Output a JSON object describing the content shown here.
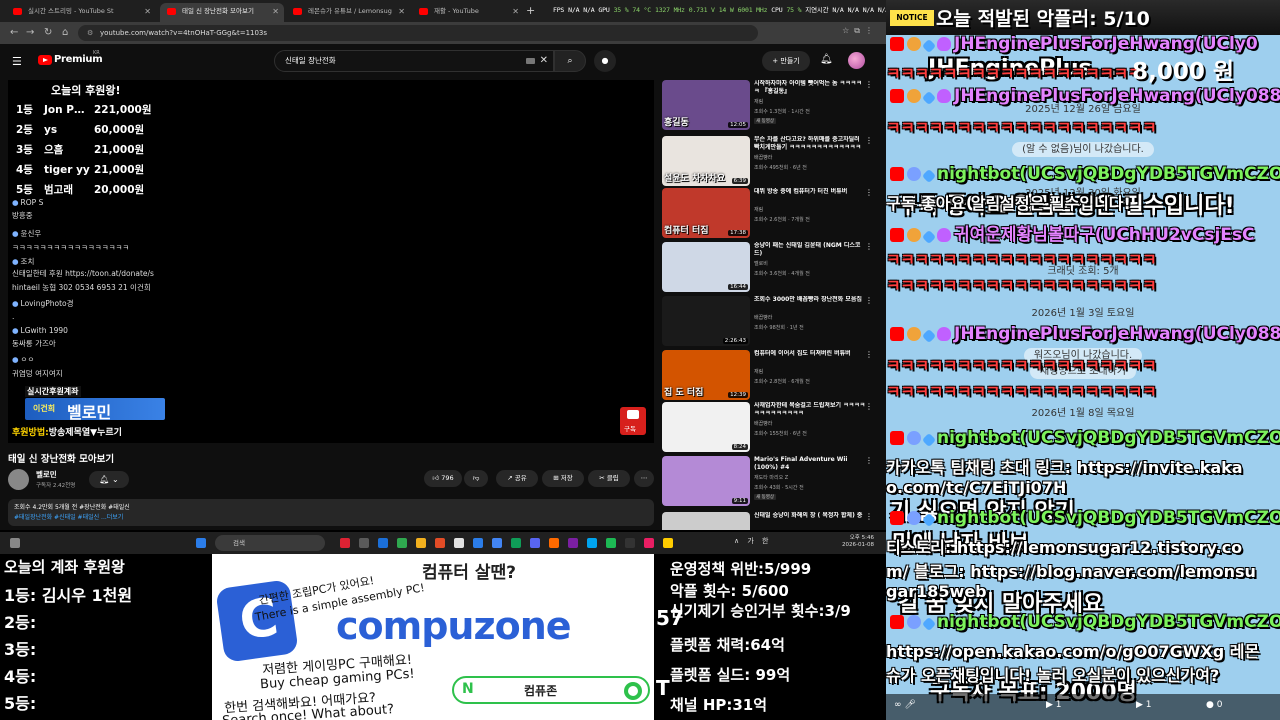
{
  "browser": {
    "tabs": [
      {
        "label": "실시간 스트리밍 - YouTube St"
      },
      {
        "label": "태일 신 장난전화 모아보기"
      },
      {
        "label": "레몬슈가 유튜브 / Lemonsug"
      },
      {
        "label": "재활 - YouTube"
      }
    ],
    "stats": [
      "FPS",
      "N/A",
      "N/A",
      "GPU",
      "35 %",
      "74 °C",
      "1327 MHz",
      "0.731 V",
      "14 W",
      "6001 MHz",
      "CPU",
      "75 %",
      "지연시간",
      "N/A",
      "N/A",
      "N/A",
      "N/A"
    ],
    "url": "youtube.com/watch?v=4tnOHaT-GGg&t=1103s"
  },
  "youtube": {
    "brand": "Premium",
    "region": "KR",
    "search_query": "신태일 장난전화",
    "create_label": "만들기"
  },
  "player": {
    "donor_title": "오늘의 후원왕!",
    "donors": [
      {
        "rank": "1등",
        "name": "Jon P…",
        "amount": "221,000원"
      },
      {
        "rank": "2등",
        "name": "ys",
        "amount": "60,000원"
      },
      {
        "rank": "3등",
        "name": "으흠",
        "amount": "21,000원"
      },
      {
        "rank": "4등",
        "name": "tiger yy",
        "amount": "21,000원"
      },
      {
        "rank": "5등",
        "name": "범고래",
        "amount": "20,000원"
      }
    ],
    "chat_lines": [
      "ROP S",
      "방흥중",
      "윤신우",
      "ㅋㅋㅋㅋㅋㅋㅋㅋㅋㅋㅋㅋㅋㅋㅋㅋㅋ",
      "조치",
      "신태일한테 후원 https://toon.at/donate/s",
      "hintaeil 농협 302 0534 6953 21 이건희",
      "LovingPhoto경",
      ".",
      "LGwith 1990",
      "동싸롱 가즈아",
      "ㅇㅇ",
      "귀염덩 여지여지"
    ],
    "badge_top": "실시간후원계좌",
    "badge_name_small": "이건희",
    "badge_name": "벨로민",
    "how_prefix": "후원방법:",
    "how_text": "방송제목열▼누르기",
    "subscribe_label": "구독"
  },
  "video": {
    "title": "태일 신 장난전화 모아보기",
    "channel": "벨로민",
    "subscribers": "구독자 2.42천명",
    "likes": "796",
    "share": "공유",
    "save": "저장",
    "clip": "클립",
    "desc_line1": "조회수 4.2만회  5개월 전  #장난전화 #태일신",
    "desc_line2": "#태일장난전화 #신태일 #태일신 ...더보기"
  },
  "sidebar": [
    {
      "title": "시작하자마자 아이템 뺏어먹는 놈 ㅋㅋㅋㅋㅋ 『홍길동』",
      "channel": "재림",
      "meta": "조회수 1.3천회 · 1시간 전",
      "badge": "새 동영상",
      "duration": "12:05",
      "caption": "홍길동",
      "thumb": "#6a4b8c"
    },
    {
      "title": "무슨 차를 산다고요? 하위매를 중고차딜러 빡치게만들기 ㅋㅋㅋㅋㅋㅋㅋㅋㅋㅋㅋㅋㅋㅋㅋ",
      "channel": "배꼽빵라",
      "meta": "조회수 495천회 · 6년 전",
      "badge": "",
      "duration": "6:39",
      "caption": "설윤도 차차차요",
      "thumb": "#e9e4df"
    },
    {
      "title": "대뷔 방송 중에 컴퓨터가 터진 버튜버",
      "channel": "재림",
      "meta": "조회수 2.6천회 · 7개월 전",
      "badge": "",
      "duration": "17:38",
      "caption": "컴퓨터 터짐",
      "thumb": "#c0392b"
    },
    {
      "title": "승냥이 패는 신태일 김윤태 (NGM 디스코드)",
      "channel": "멜로비",
      "meta": "조회수 3.6천회 · 4개월 전",
      "badge": "",
      "duration": "16:44",
      "caption": "",
      "thumb": "#cfd8e6"
    },
    {
      "title": "조회수 3000만 배꼽빵라 장난전화 모음집",
      "channel": "배꼽빵라",
      "meta": "조회수 98천회 · 1년 전",
      "badge": "",
      "duration": "2:26:43",
      "caption": "",
      "thumb": "#1a1a1a"
    },
    {
      "title": "컴퓨터에 이어서 집도 터져버린 버튜버",
      "channel": "재림",
      "meta": "조회수 2.8천회 · 6개월 전",
      "badge": "",
      "duration": "12:39",
      "caption": "집 도 터짐",
      "thumb": "#d35400"
    },
    {
      "title": "사채업자한테 목숨걸고 드립쳐보기 ㅋㅋㅋㅋㅋㅋㅋㅋㅋㅋㅋㅋㅋ",
      "channel": "배꼽빵라",
      "meta": "조회수 155천회 · 6년 전",
      "badge": "",
      "duration": "8:24",
      "caption": "",
      "thumb": "#f1f1f1"
    },
    {
      "title": "Mario's Final Adventure Wii (100%) #4",
      "channel": "재도타 마리오 Z",
      "meta": "조회수 43회 · 5시간 전",
      "badge": "새 동영상",
      "duration": "9:11",
      "caption": "",
      "thumb": "#b48ad6"
    },
    {
      "title": "신태일 승냥이 화해의 장 ( 목정자 합체) 중",
      "channel": "",
      "meta": "",
      "badge": "",
      "duration": "",
      "caption": "",
      "thumb": "#cccccc"
    }
  ],
  "taskbar": {
    "search": "검색",
    "tray": "∧ 가 한",
    "time": "오후 5:46",
    "date": "2026-01-08"
  },
  "bottom_left": {
    "title": "오늘의 계좌 후원왕",
    "rows": [
      "1등: 김시우 1천원",
      "2등:",
      "3등:",
      "4등:",
      "5등:"
    ]
  },
  "ad": {
    "question": "컴퓨터 살땐?",
    "logo_letter": "C",
    "line_a": "간편한 조립PC가 있어요!",
    "line_b": "There is a simple assembly PC!",
    "brand": "compuzone",
    "line_c": "저렴한 게이밍PC 구매해요!",
    "line_d": "Buy cheap gaming PCs!",
    "line_e": "한번 검색해봐요! 어때가요?",
    "line_f": "Search once! What about?",
    "pill_n": "N",
    "pill_text": "컴퓨존"
  },
  "stats_overlay": {
    "rows": [
      "운영정책 위반:5/999",
      "악플 횟수: 5/600",
      "신기제기 승인거부 횟수:3/9",
      "플렛폼 채력:64억",
      "플렛폼 실드: 99억",
      "채널 HP:31억"
    ],
    "left_num": "57",
    "left_t": "T"
  },
  "chat": {
    "notice_label": "NOTICE",
    "notice_text": "오늘 적발된 악플러: 5/10",
    "amount": "8,000 원",
    "lines": [
      {
        "kind": "pname",
        "text": "JHEnginePlusForJeHwang(UCly0"
      },
      {
        "kind": "msg",
        "text": "ㅋㅋㅋㅋㅋㅋㅋㅋㅋㅋㅋㅋㅋㅋㅋㅋㅋㅋ"
      },
      {
        "kind": "pname",
        "text": "JHEnginePlusForJeHwang(UCly088"
      },
      {
        "kind": "msg",
        "text": "ㅋㅋㅋㅋㅋㅋㅋㅋㅋㅋㅋㅋㅋㅋㅋㅋㅋㅋㅋ"
      },
      {
        "kind": "name",
        "text": "nightbot(UCSvjQBDgYDB5TGVmCZO"
      },
      {
        "kind": "wmsg",
        "text": "구독 좋아요 알림설정은 필수입니다!"
      },
      {
        "kind": "pname",
        "text": "귀여운제황님볼따구(UChHU2vCsjEsC"
      },
      {
        "kind": "msg",
        "text": "ㅋㅋㅋㅋㅋㅋㅋㅋㅋㅋㅋㅋㅋㅋㅋㅋㅋㅋㅋ"
      },
      {
        "kind": "msg",
        "text": "ㅋㅋㅋㅋㅋㅋㅋㅋㅋㅋㅋㅋㅋㅋㅋㅋㅋㅋㅋ"
      },
      {
        "kind": "pname",
        "text": "JHEnginePlusForJeHwang(UCly088"
      },
      {
        "kind": "msg",
        "text": "ㅋㅋㅋㅋㅋㅋㅋㅋㅋㅋㅋㅋㅋㅋㅋㅋㅋㅋㅋ"
      },
      {
        "kind": "msg",
        "text": "ㅋㅋㅋㅋㅋㅋㅋㅋㅋㅋㅋㅋㅋㅋㅋㅋㅋㅋㅋ"
      },
      {
        "kind": "name",
        "text": "nightbot(UCSvjQBDgYDB5TGVmCZO"
      },
      {
        "kind": "wmsg",
        "text": "카카오톡 팀채팅 초대 링크: https://invite.kaka"
      },
      {
        "kind": "wmsg",
        "text": "o.com/tc/C7EiTJi07H"
      },
      {
        "kind": "name",
        "text": "nightbot(UCSvjQBDgYDB5TGVmCZO"
      },
      {
        "kind": "wmsg",
        "text": "티스토리: https://lemonsugar12.tistory.co"
      },
      {
        "kind": "wmsg",
        "text": "m/ 블로그: https://blog.naver.com/lemonsu"
      },
      {
        "kind": "wmsg",
        "text": "gar185web"
      },
      {
        "kind": "name",
        "text": "nightbot(UCSvjQBDgYDB5TGVmCZO"
      },
      {
        "kind": "wmsg",
        "text": "https://open.kakao.com/o/gO07GWXg 레몬"
      },
      {
        "kind": "wmsg",
        "text": "슈가 오픈채팅입니다! 놀러 오실분이 있으신가여?"
      }
    ],
    "system_msgs": [
      "2025년 12월 26일 금요일",
      "(알 수 없음)님이 나갔습니다.",
      "2025년 12월 30일 화요일",
      "크래딧 조회: 5개",
      "2026년 1월 3일 토요일",
      "워즈오님이 나갔습니다.",
      "채팅방으로 초대하기",
      "2026년 1월 8일 목요일"
    ],
    "big_white": [
      "JHEnginePlus...",
      "구독 좋아요 알림설정은 필수입니다!",
      "기 싫으면 앉지 않기",
      "밑에 남자 바보 ...",
      "길 꿈 잊지 말아주세요",
      "구독자 목표: 2000명"
    ]
  }
}
